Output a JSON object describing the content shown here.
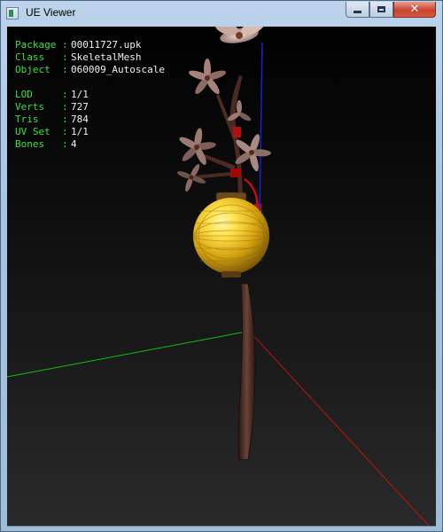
{
  "window": {
    "title": "UE Viewer"
  },
  "controls": {
    "minimize": "minimize",
    "maximize": "maximize",
    "close": "✕"
  },
  "info": {
    "package_label": "Package : ",
    "package": "00011727.upk",
    "class_label": "Class   : ",
    "class": "SkeletalMesh",
    "object_label": "Object  : ",
    "object": "060009_Autoscale",
    "lod_label": "LOD     : ",
    "lod": "1/1",
    "verts_label": "Verts   : ",
    "verts": "727",
    "tris_label": "Tris    : ",
    "tris": "784",
    "uvset_label": "UV Set  : ",
    "uvset": "1/1",
    "bones_label": "Bones   : ",
    "bones": "4"
  },
  "colors": {
    "label": "#3ee03e",
    "value": "#f0f0f0",
    "axis_x": "#c01010",
    "axis_y": "#10c010",
    "axis_z": "#1010c0",
    "lantern": "#f0c020",
    "branch": "#4a2a22"
  }
}
